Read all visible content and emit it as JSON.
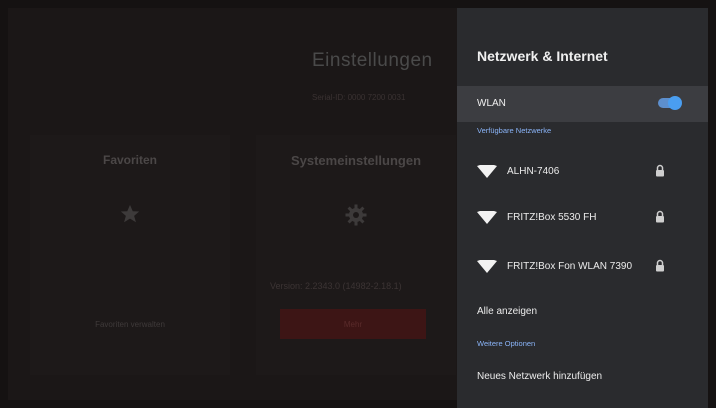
{
  "background": {
    "title": "Einstellungen",
    "serial": "Serial-ID: 0000 7200 0031",
    "favorites": {
      "title": "Favoriten",
      "icon": "star-icon",
      "manage_label": "Favoriten verwalten"
    },
    "system": {
      "title": "Systemeinstellungen",
      "icon": "gear-icon",
      "version": "Version: 2.2343.0 (14982-2.18.1)",
      "more_label": "Mehr"
    }
  },
  "panel": {
    "title": "Netzwerk & Internet",
    "wlan": {
      "label": "WLAN",
      "enabled": true
    },
    "available_heading": "Verfügbare Netzwerke",
    "networks": [
      {
        "name": "ALHN-7406",
        "icon": "wifi-icon",
        "secured": true
      },
      {
        "name": "FRITZ!Box 5530 FH",
        "icon": "wifi-icon",
        "secured": true
      },
      {
        "name": "FRITZ!Box Fon WLAN 7390",
        "icon": "wifi-icon",
        "secured": true
      }
    ],
    "show_all": "Alle anzeigen",
    "more_options_heading": "Weitere Optionen",
    "add_network": "Neues Netzwerk hinzufügen"
  },
  "colors": {
    "accent": "#8ab4f8",
    "toggle": "#4a9ef0",
    "panel_bg": "#2a2b2e"
  }
}
